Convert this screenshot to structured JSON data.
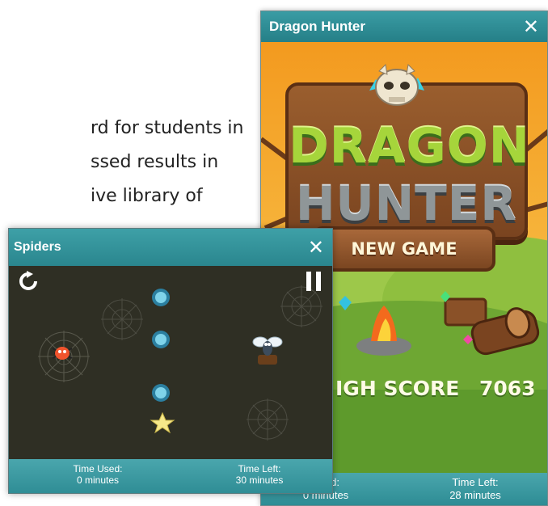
{
  "background_text": {
    "lines": [
      "rd for students in",
      "ssed results in",
      "ive library of"
    ]
  },
  "dragon_hunter": {
    "title": "Dragon Hunter",
    "close_glyph": "✕",
    "logo_line1": "DRAGON",
    "logo_line2": "HUNTER",
    "new_game_label": "NEW GAME",
    "high_score_label": "IGH SCORE",
    "high_score_value": "7063",
    "footer": {
      "time_used_label": "Used:",
      "time_used_value": "0 minutes",
      "time_left_label": "Time Left:",
      "time_left_value": "28 minutes"
    }
  },
  "spiders": {
    "title": "Spiders",
    "close_glyph": "✕",
    "footer": {
      "time_used_label": "Time Used:",
      "time_used_value": "0 minutes",
      "time_left_label": "Time Left:",
      "time_left_value": "30 minutes"
    },
    "icons": {
      "restart": "restart-icon",
      "pause": "pause-icon",
      "spider": "spider-icon",
      "fly": "fly-icon",
      "star": "star-icon",
      "node": "node-icon",
      "web": "spider-web-icon"
    }
  },
  "colors": {
    "titlebar": "#2f8f97",
    "dh_sky": "#f39a1f",
    "dh_grass": "#7cb837",
    "wood": "#8a5128",
    "sp_board": "#2f2f24"
  }
}
